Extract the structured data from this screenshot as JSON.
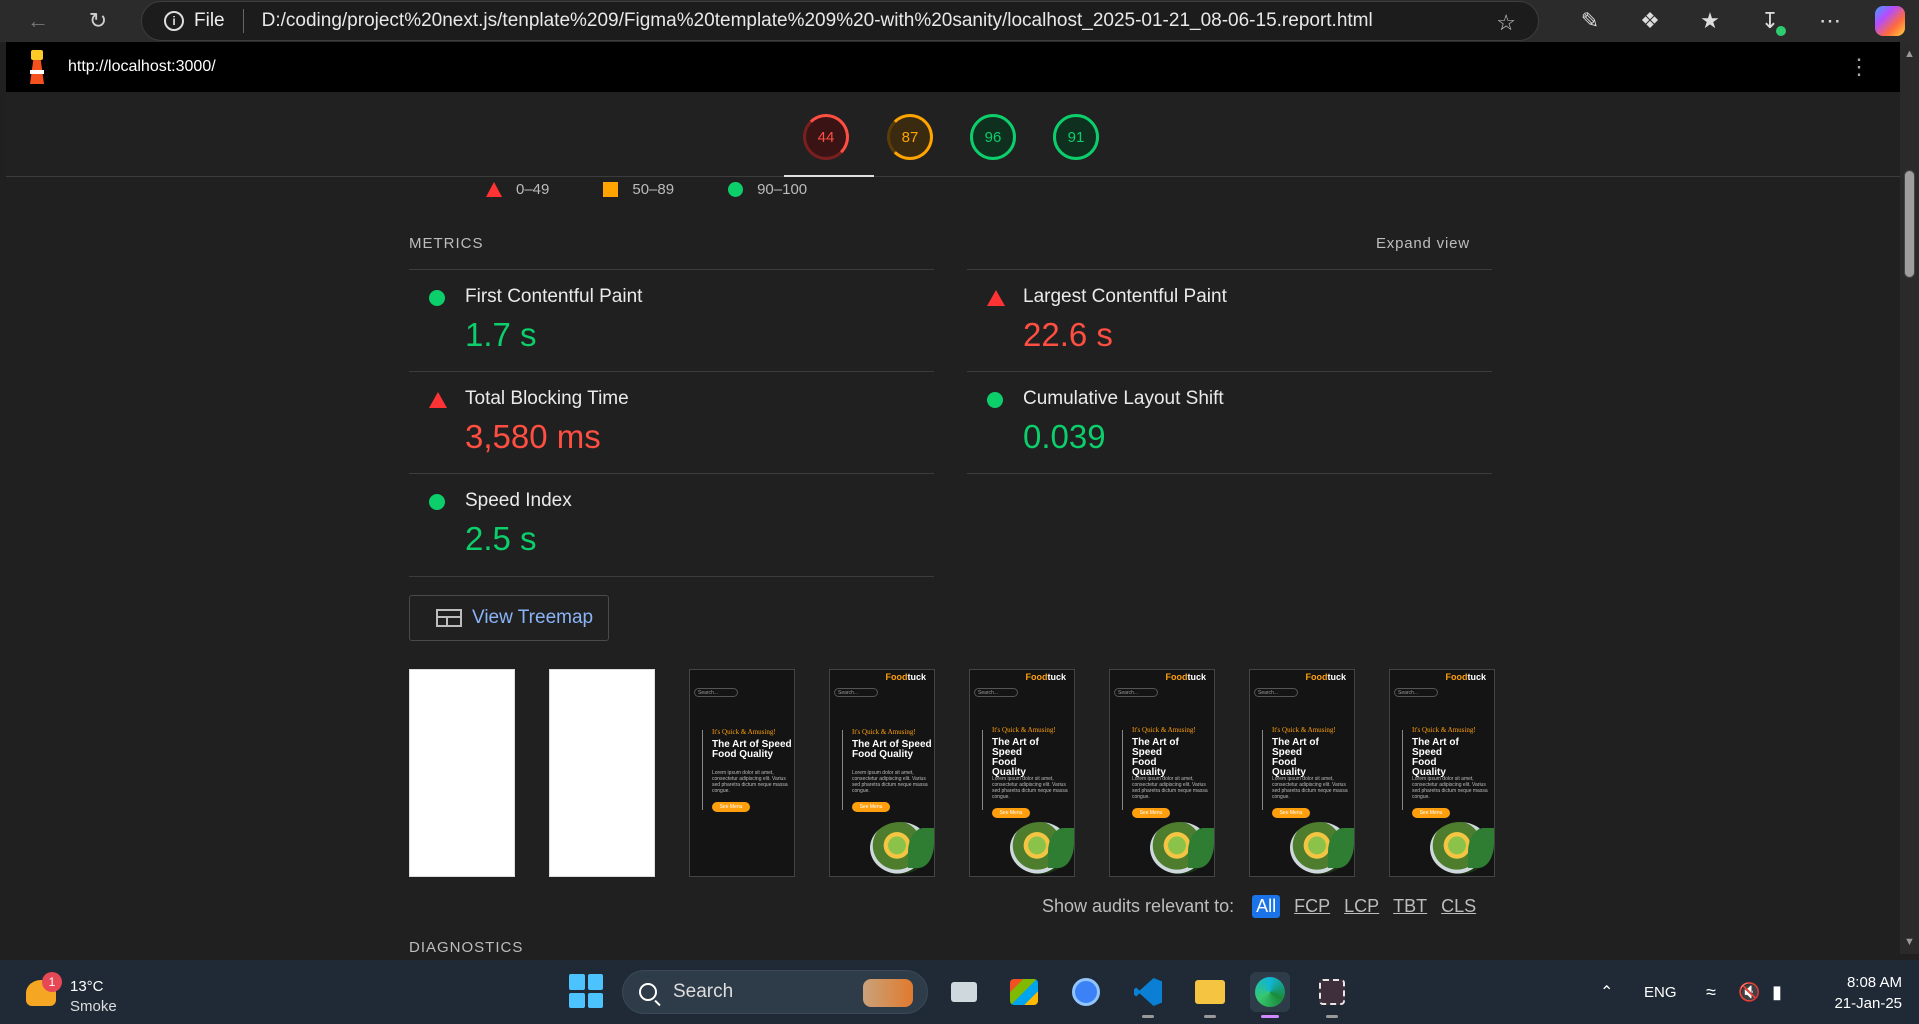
{
  "browser": {
    "file_label": "File",
    "url": "D:/coding/project%20next.js/tenplate%209/Figma%20template%209%20-with%20sanity/localhost_2025-01-21_08-06-15.report.html"
  },
  "report": {
    "page_url": "http://localhost:3000/",
    "scores": [
      {
        "value": "44",
        "level": "red"
      },
      {
        "value": "87",
        "level": "orange"
      },
      {
        "value": "96",
        "level": "green"
      },
      {
        "value": "91",
        "level": "green"
      }
    ],
    "legend": {
      "fail": "0–49",
      "average": "50–89",
      "pass": "90–100"
    },
    "metrics_title": "METRICS",
    "expand_view": "Expand view",
    "metrics": {
      "fcp": {
        "name": "First Contentful Paint",
        "value": "1.7 s",
        "status": "pass"
      },
      "lcp": {
        "name": "Largest Contentful Paint",
        "value": "22.6 s",
        "status": "fail"
      },
      "tbt": {
        "name": "Total Blocking Time",
        "value": "3,580 ms",
        "status": "fail"
      },
      "cls": {
        "name": "Cumulative Layout Shift",
        "value": "0.039",
        "status": "pass"
      },
      "si": {
        "name": "Speed Index",
        "value": "2.5 s",
        "status": "pass"
      }
    },
    "treemap_label": "View Treemap",
    "thumbnail": {
      "brand_prefix": "Food",
      "brand_suffix": "tuck",
      "search": "Search...",
      "tagline": "It's Quick & Amusing!",
      "headline_wide": "The Art of Speed Food Quality",
      "headline_narrow": "The Art of Speed Food Quality",
      "body": "Lorem ipsum dolor sit amet, consectetur adipiscing elit. Varius sed pharetra dictum neque massa congue.",
      "button": "See Menu"
    },
    "filter": {
      "label": "Show audits relevant to:",
      "chips": [
        "All",
        "FCP",
        "LCP",
        "TBT",
        "CLS"
      ]
    },
    "diagnostics_title": "DIAGNOSTICS"
  },
  "taskbar": {
    "weather_badge": "1",
    "temperature": "13°C",
    "condition": "Smoke",
    "search_placeholder": "Search",
    "language": "ENG",
    "time": "8:08 AM",
    "date": "21-Jan-25"
  }
}
